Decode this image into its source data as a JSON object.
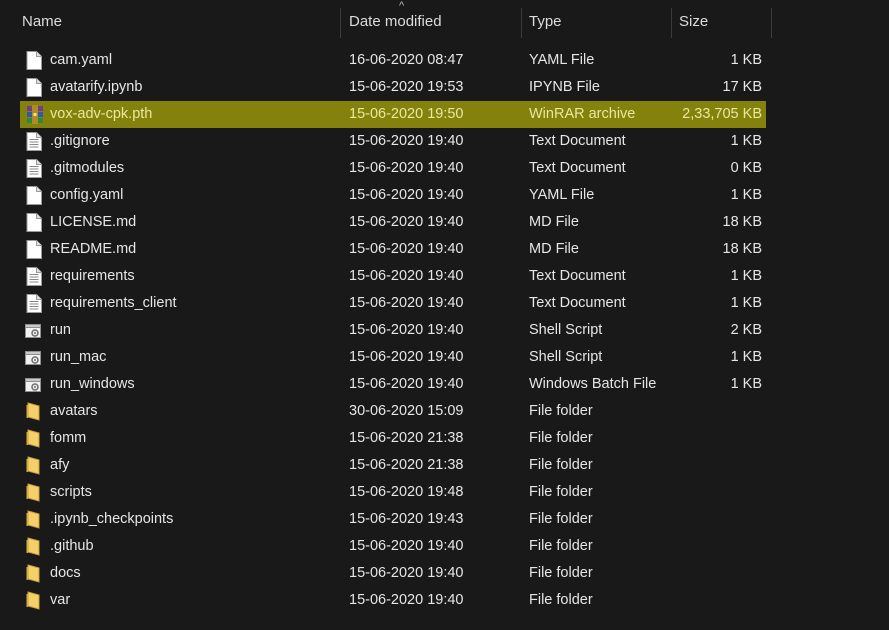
{
  "columns": {
    "name": "Name",
    "date": "Date modified",
    "type": "Type",
    "size": "Size"
  },
  "sort_indicator": "^",
  "rows": [
    {
      "name": "cam.yaml",
      "date": "16-06-2020 08:47",
      "type": "YAML File",
      "size": "1 KB",
      "icon": "file-icon"
    },
    {
      "name": "avatarify.ipynb",
      "date": "15-06-2020 19:53",
      "type": "IPYNB File",
      "size": "17 KB",
      "icon": "file-icon"
    },
    {
      "name": "vox-adv-cpk.pth",
      "date": "15-06-2020 19:50",
      "type": "WinRAR archive",
      "size": "2,33,705 KB",
      "icon": "winrar-icon",
      "selected": true
    },
    {
      "name": ".gitignore",
      "date": "15-06-2020 19:40",
      "type": "Text Document",
      "size": "1 KB",
      "icon": "text-file-icon"
    },
    {
      "name": ".gitmodules",
      "date": "15-06-2020 19:40",
      "type": "Text Document",
      "size": "0 KB",
      "icon": "text-file-icon"
    },
    {
      "name": "config.yaml",
      "date": "15-06-2020 19:40",
      "type": "YAML File",
      "size": "1 KB",
      "icon": "file-icon"
    },
    {
      "name": "LICENSE.md",
      "date": "15-06-2020 19:40",
      "type": "MD File",
      "size": "18 KB",
      "icon": "file-icon"
    },
    {
      "name": "README.md",
      "date": "15-06-2020 19:40",
      "type": "MD File",
      "size": "18 KB",
      "icon": "file-icon"
    },
    {
      "name": "requirements",
      "date": "15-06-2020 19:40",
      "type": "Text Document",
      "size": "1 KB",
      "icon": "text-file-icon"
    },
    {
      "name": "requirements_client",
      "date": "15-06-2020 19:40",
      "type": "Text Document",
      "size": "1 KB",
      "icon": "text-file-icon"
    },
    {
      "name": "run",
      "date": "15-06-2020 19:40",
      "type": "Shell Script",
      "size": "2 KB",
      "icon": "script-icon"
    },
    {
      "name": "run_mac",
      "date": "15-06-2020 19:40",
      "type": "Shell Script",
      "size": "1 KB",
      "icon": "script-icon"
    },
    {
      "name": "run_windows",
      "date": "15-06-2020 19:40",
      "type": "Windows Batch File",
      "size": "1 KB",
      "icon": "script-icon"
    },
    {
      "name": "avatars",
      "date": "30-06-2020 15:09",
      "type": "File folder",
      "size": "",
      "icon": "folder-icon"
    },
    {
      "name": "fomm",
      "date": "15-06-2020 21:38",
      "type": "File folder",
      "size": "",
      "icon": "folder-icon"
    },
    {
      "name": "afy",
      "date": "15-06-2020 21:38",
      "type": "File folder",
      "size": "",
      "icon": "folder-icon"
    },
    {
      "name": "scripts",
      "date": "15-06-2020 19:48",
      "type": "File folder",
      "size": "",
      "icon": "folder-icon"
    },
    {
      "name": ".ipynb_checkpoints",
      "date": "15-06-2020 19:43",
      "type": "File folder",
      "size": "",
      "icon": "folder-icon"
    },
    {
      "name": ".github",
      "date": "15-06-2020 19:40",
      "type": "File folder",
      "size": "",
      "icon": "folder-icon"
    },
    {
      "name": "docs",
      "date": "15-06-2020 19:40",
      "type": "File folder",
      "size": "",
      "icon": "folder-icon"
    },
    {
      "name": "var",
      "date": "15-06-2020 19:40",
      "type": "File folder",
      "size": "",
      "icon": "folder-icon"
    }
  ],
  "colors": {
    "background": "#191919",
    "selection": "#84820c",
    "selection_text": "#e8e8a0",
    "text": "#e6e6e6",
    "folder": "#e8c25a"
  }
}
